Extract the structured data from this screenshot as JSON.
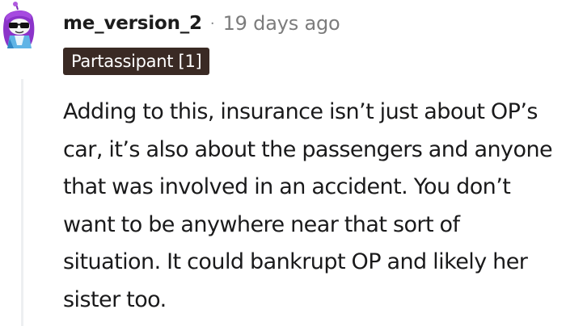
{
  "comment": {
    "username": "me_version_2",
    "separator": "·",
    "timestamp": "19 days ago",
    "flair": "Partassipant [1]",
    "body": "Adding to this, insurance isn’t just about OP’s car, it’s also about the passengers and anyone that was involved in an accident. You don’t want to be anywhere near that sort of situation. It could bankrupt OP and likely her sister too.",
    "avatar_icon": "snoo-avatar-icon"
  },
  "colors": {
    "flair_background": "#3a2a24",
    "flair_text": "#ffffff",
    "username": "#1c1c1c",
    "meta_text": "#7c7c7c",
    "body_text": "#1a1a1b",
    "thread_line": "#edeff1",
    "avatar_purple": "#8b34c9"
  }
}
